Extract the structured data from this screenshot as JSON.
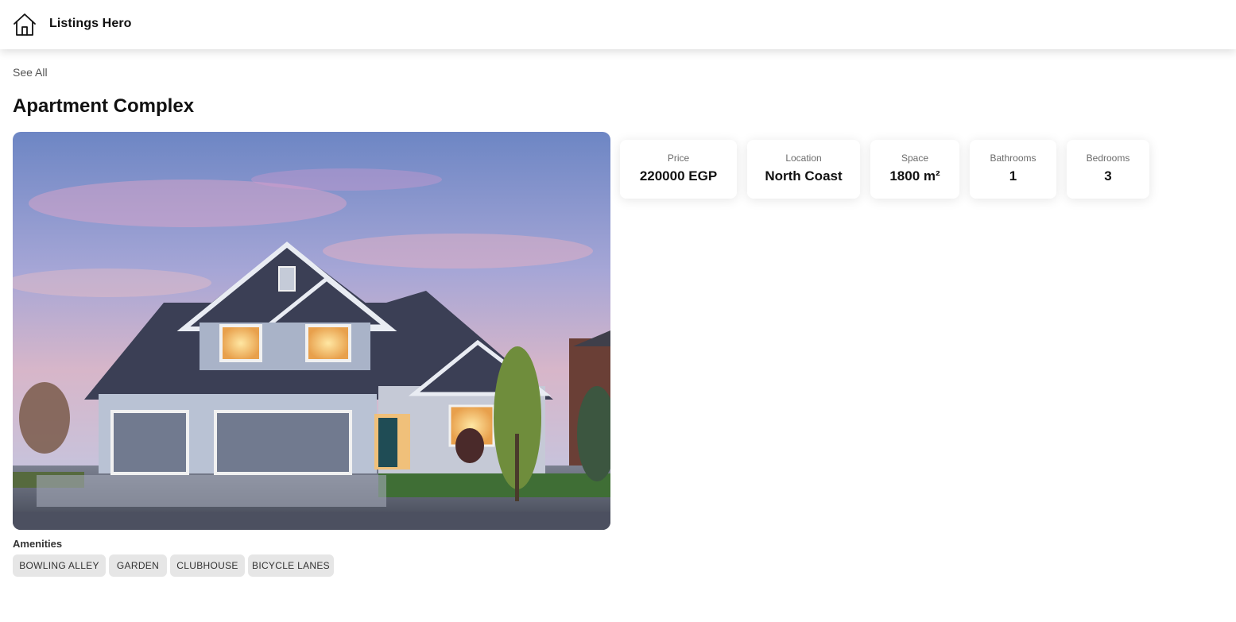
{
  "header": {
    "brand": "Listings Hero",
    "home_icon": "home-icon"
  },
  "nav": {
    "see_all": "See All"
  },
  "listing": {
    "title": "Apartment Complex",
    "image_description_icon": "house-photo",
    "stats": [
      {
        "label": "Price",
        "value": "220000 EGP"
      },
      {
        "label": "Location",
        "value": "North Coast"
      },
      {
        "label": "Space",
        "value": "1800 m²"
      },
      {
        "label": "Bathrooms",
        "value": "1"
      },
      {
        "label": "Bedrooms",
        "value": "3"
      }
    ],
    "amenities_title": "Amenities",
    "amenities": [
      "BOWLING ALLEY",
      "GARDEN",
      "CLUBHOUSE",
      "BICYCLE LANES"
    ]
  },
  "colors": {
    "tag_background": "#e6e6e6",
    "card_shadow": "rgba(0,0,0,0.10)"
  }
}
